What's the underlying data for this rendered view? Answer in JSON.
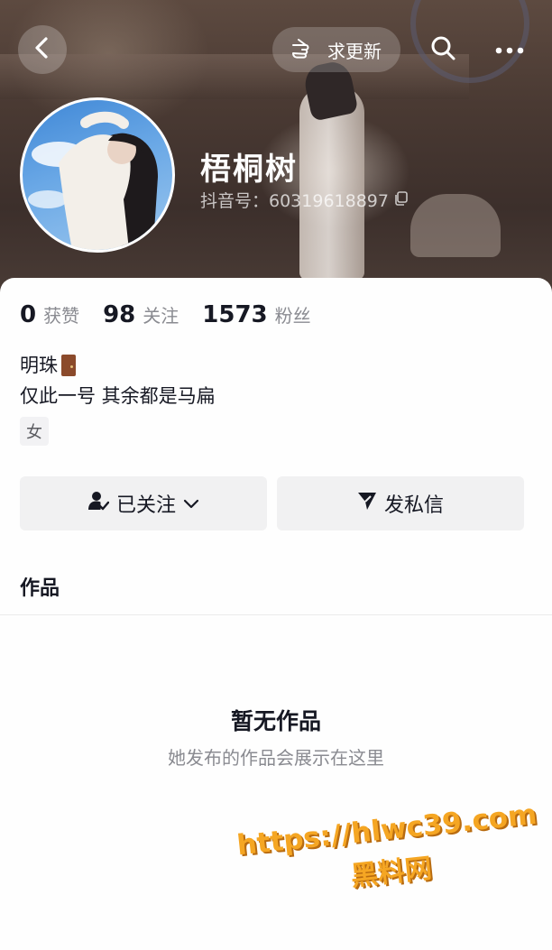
{
  "header": {
    "request_update_label": "求更新",
    "icons": {
      "back": "back-arrow-icon",
      "request_update": "hand-point-icon",
      "search": "search-icon",
      "more": "more-dots-icon"
    }
  },
  "profile": {
    "nickname": "梧桐树",
    "douyin_id": "抖音号：60319618897",
    "copy_icon": "copy-icon"
  },
  "stats": [
    {
      "value": "0",
      "label": "获赞"
    },
    {
      "value": "98",
      "label": "关注"
    },
    {
      "value": "1573",
      "label": "粉丝"
    }
  ],
  "bio": {
    "line1": "明珠",
    "line1_emoji": "door-emoji",
    "line2": "仅此一号 其余都是马扁"
  },
  "gender_tag": "女",
  "actions": {
    "follow_label": "已关注",
    "message_label": "发私信"
  },
  "works": {
    "tab_label": "作品",
    "empty_title": "暂无作品",
    "empty_subtitle": "她发布的作品会展示在这里"
  },
  "watermark": {
    "url": "https://hlwc39.com",
    "name": "黑料网"
  },
  "colors": {
    "accent_watermark": "#f5a623",
    "text_primary": "#161823",
    "text_secondary": "#8a8b91",
    "button_bg": "#f1f1f2"
  }
}
